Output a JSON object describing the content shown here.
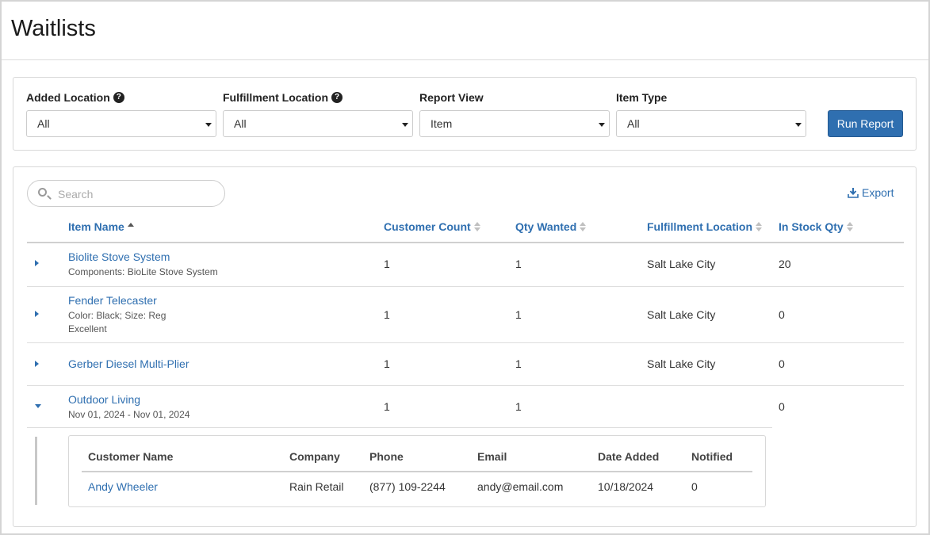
{
  "page": {
    "title": "Waitlists"
  },
  "filters": {
    "added_location": {
      "label": "Added Location",
      "value": "All",
      "help": "?"
    },
    "fulfillment_location": {
      "label": "Fulfillment Location",
      "value": "All",
      "help": "?"
    },
    "report_view": {
      "label": "Report View",
      "value": "Item"
    },
    "item_type": {
      "label": "Item Type",
      "value": "All"
    },
    "run_label": "Run Report"
  },
  "toolbar": {
    "search_placeholder": "Search",
    "export_label": "Export"
  },
  "table": {
    "headers": {
      "item_name": "Item Name",
      "customer_count": "Customer Count",
      "qty_wanted": "Qty Wanted",
      "fulfillment_location": "Fulfillment Location",
      "in_stock_qty": "In Stock Qty"
    },
    "rows": [
      {
        "name": "Biolite Stove System",
        "sub1": "Components: BioLite Stove System",
        "sub2": "",
        "customer_count": "1",
        "qty_wanted": "1",
        "location": "Salt Lake City",
        "in_stock": "20",
        "expanded": false
      },
      {
        "name": "Fender Telecaster",
        "sub1": "Color: Black; Size: Reg",
        "sub2": "Excellent",
        "customer_count": "1",
        "qty_wanted": "1",
        "location": "Salt Lake City",
        "in_stock": "0",
        "expanded": false
      },
      {
        "name": "Gerber Diesel Multi-Plier",
        "sub1": "",
        "sub2": "",
        "customer_count": "1",
        "qty_wanted": "1",
        "location": "Salt Lake City",
        "in_stock": "0",
        "expanded": false
      },
      {
        "name": "Outdoor Living",
        "sub1": "Nov 01, 2024 - Nov 01, 2024",
        "sub2": "",
        "customer_count": "1",
        "qty_wanted": "1",
        "location": "",
        "in_stock": "0",
        "expanded": true
      }
    ]
  },
  "detail": {
    "headers": {
      "customer_name": "Customer Name",
      "company": "Company",
      "phone": "Phone",
      "email": "Email",
      "date_added": "Date Added",
      "notified": "Notified"
    },
    "rows": [
      {
        "customer_name": "Andy Wheeler",
        "company": "Rain Retail",
        "phone": "(877) 109-2244",
        "email": "andy@email.com",
        "date_added": "10/18/2024",
        "notified": "0"
      }
    ]
  }
}
